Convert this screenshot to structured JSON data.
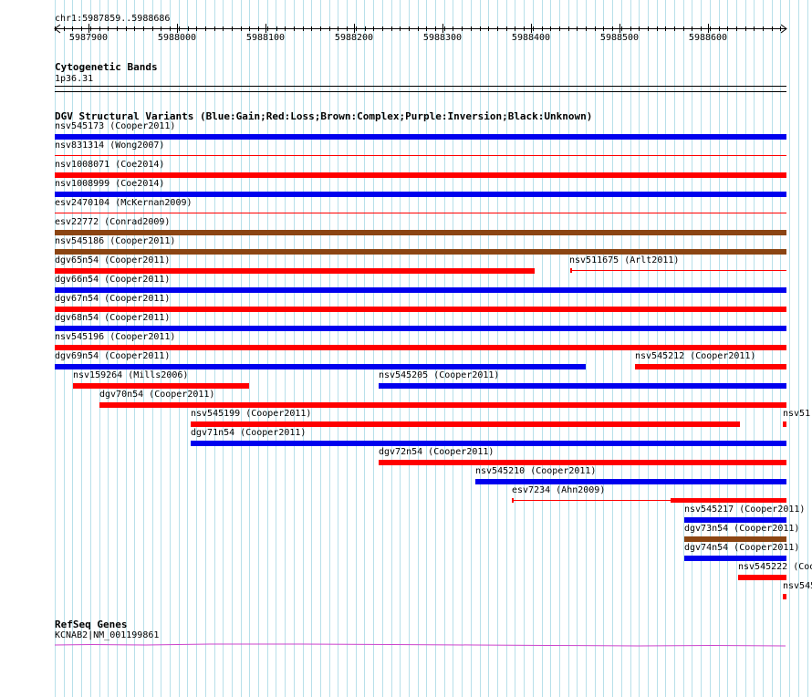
{
  "colors": {
    "gain": "#0000ee",
    "loss": "#ff0000",
    "complex": "#8b4513",
    "inversion": "#800080",
    "unknown": "#000000",
    "grid": "#b8e0ea",
    "refseq": "#cc44cc"
  },
  "ruler": {
    "label": "chr1:5987859..5988686",
    "ticks": [
      "5987900",
      "5988000",
      "5988100",
      "5988200",
      "5988300",
      "5988400",
      "5988500",
      "5988600"
    ]
  },
  "cytoband": {
    "title": "Cytogenetic Bands",
    "band": "1p36.31"
  },
  "dgv": {
    "title": "DGV Structural Variants (Blue:Gain;Red:Loss;Brown:Complex;Purple:Inversion;Black:Unknown)",
    "features": [
      {
        "label": "nsv545173 (Cooper2011)",
        "type": "gain",
        "style": "bar"
      },
      {
        "label": "nsv831314 (Wong2007)",
        "type": "loss",
        "style": "thin"
      },
      {
        "label": "nsv1008071 (Coe2014)",
        "type": "loss",
        "style": "bar"
      },
      {
        "label": "nsv1008999 (Coe2014)",
        "type": "gain",
        "style": "bar"
      },
      {
        "label": "esv2470104 (McKernan2009)",
        "type": "loss",
        "style": "thin"
      },
      {
        "label": "esv22772 (Conrad2009)",
        "type": "complex",
        "style": "bar"
      },
      {
        "label": "nsv545186 (Cooper2011)",
        "type": "complex",
        "style": "bar"
      },
      {
        "label": "dgv65n54 (Cooper2011)",
        "type": "loss",
        "style": "bar"
      },
      {
        "label": "nsv511675 (Arlt2011)",
        "type": "loss",
        "style": "thin"
      },
      {
        "label": "dgv66n54 (Cooper2011)",
        "type": "gain",
        "style": "bar"
      },
      {
        "label": "dgv67n54 (Cooper2011)",
        "type": "loss",
        "style": "bar"
      },
      {
        "label": "dgv68n54 (Cooper2011)",
        "type": "gain",
        "style": "bar"
      },
      {
        "label": "nsv545196 (Cooper2011)",
        "type": "loss",
        "style": "bar"
      },
      {
        "label": "dgv69n54 (Cooper2011)",
        "type": "gain",
        "style": "bar"
      },
      {
        "label": "nsv545212 (Cooper2011)",
        "type": "loss",
        "style": "bar"
      },
      {
        "label": "nsv159264 (Mills2006)",
        "type": "loss",
        "style": "bar"
      },
      {
        "label": "nsv545205 (Cooper2011)",
        "type": "gain",
        "style": "bar"
      },
      {
        "label": "dgv70n54 (Cooper2011)",
        "type": "loss",
        "style": "bar"
      },
      {
        "label": "nsv545199 (Cooper2011)",
        "type": "loss",
        "style": "bar"
      },
      {
        "label": "nsv51",
        "type": "loss",
        "style": "bar"
      },
      {
        "label": "dgv71n54 (Cooper2011)",
        "type": "gain",
        "style": "bar"
      },
      {
        "label": "dgv72n54 (Cooper2011)",
        "type": "loss",
        "style": "bar"
      },
      {
        "label": "nsv545210 (Cooper2011)",
        "type": "gain",
        "style": "bar"
      },
      {
        "label": "esv7234 (Ahn2009)",
        "type": "loss",
        "style": "split"
      },
      {
        "label": "nsv545217 (Cooper2011)",
        "type": "gain",
        "style": "bar"
      },
      {
        "label": "dgv73n54 (Cooper2011)",
        "type": "complex",
        "style": "bar"
      },
      {
        "label": "dgv74n54 (Cooper2011)",
        "type": "gain",
        "style": "bar"
      },
      {
        "label": "nsv545222 (Coo",
        "type": "loss",
        "style": "bar"
      },
      {
        "label": "nsv545",
        "type": "loss",
        "style": "bar"
      }
    ]
  },
  "refseq": {
    "title": "RefSeq Genes",
    "gene": "KCNAB2|NM_001199861"
  }
}
